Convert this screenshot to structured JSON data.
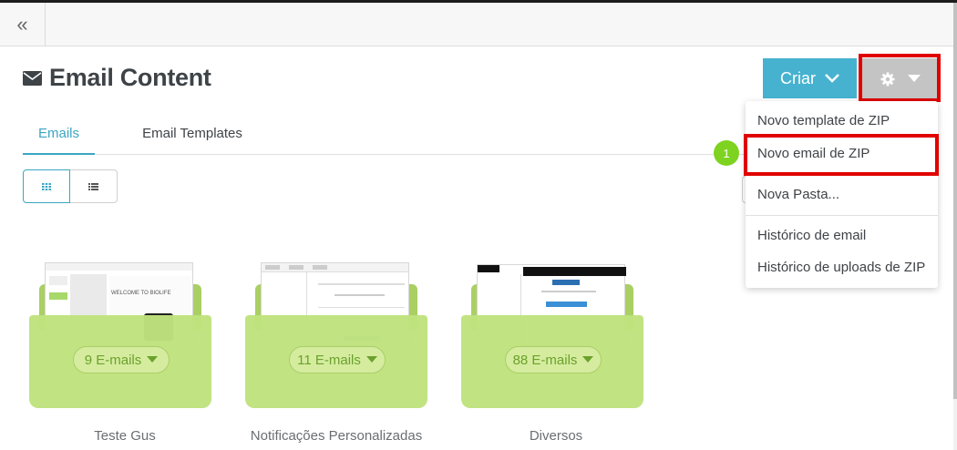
{
  "topbar": {
    "collapse_label": "«"
  },
  "page": {
    "title": "Email Content"
  },
  "tabs": [
    {
      "label": "Emails",
      "active": true
    },
    {
      "label": "Email Templates",
      "active": false
    }
  ],
  "toolbar": {
    "criar_label": "Criar"
  },
  "dropdown": {
    "items": [
      {
        "label": "Novo template de ZIP"
      },
      {
        "label": "Novo email de ZIP"
      },
      {
        "label": "Nova Pasta..."
      },
      {
        "label": "Histórico de email"
      },
      {
        "label": "Histórico de uploads de ZIP"
      }
    ]
  },
  "step_badge": "1",
  "folders": [
    {
      "name": "Teste Gus",
      "count_label": "9 E-mails",
      "preview_text": "WELCOME TO BIOLIFE"
    },
    {
      "name": "Notificações Personalizadas",
      "count_label": "11 E-mails",
      "preview_text": ""
    },
    {
      "name": "Diversos",
      "count_label": "88 E-mails",
      "preview_text": ""
    }
  ],
  "colors": {
    "accent": "#46b2cf",
    "folder_green": "#bfe27d",
    "highlight_red": "#e00000",
    "badge_green": "#7ed321"
  }
}
